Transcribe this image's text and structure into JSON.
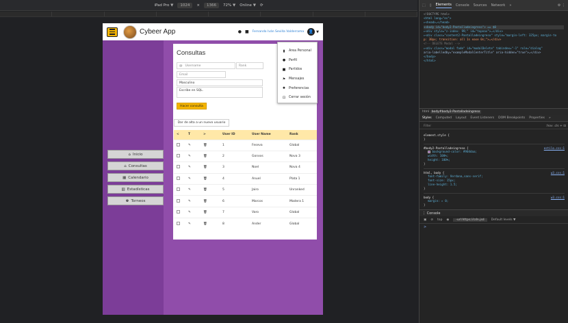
{
  "device_toolbar": {
    "device": "iPad Pro",
    "width": "1024",
    "times": "×",
    "height": "1366",
    "zoom": "72%",
    "network": "Online",
    "caret": "▼"
  },
  "topnav": {
    "app_title": "Cybeer App",
    "user_name": "Fernando Iván Sevilla Valderrama",
    "avatar_glyph": "👤"
  },
  "sidebar": {
    "items": [
      {
        "label": "Inicio",
        "icon": "home-icon",
        "glyph": "⌂"
      },
      {
        "label": "Consultas",
        "icon": "home-icon",
        "glyph": "⌂"
      },
      {
        "label": "Calendario",
        "icon": "calendar-icon",
        "glyph": "▦"
      },
      {
        "label": "Estadísticas",
        "icon": "chart-icon",
        "glyph": "▥"
      },
      {
        "label": "Torneos",
        "icon": "trophy-icon",
        "glyph": "♚"
      }
    ]
  },
  "consultas": {
    "title": "Consultas",
    "username_prefix": "@",
    "username_placeholder": "Username",
    "rank_placeholder": "Rank",
    "email_placeholder": "Email",
    "gender_value": "Masculino",
    "sql_placeholder": "Escribe en SQL.",
    "query_button": "Hacer consulta",
    "add_user_button": "Dar de alta a un nuevo usuario"
  },
  "table": {
    "headers": [
      "",
      "",
      "",
      "User ID",
      "User Name",
      "Rank"
    ],
    "sort_glyphs": [
      "<",
      "T",
      ">"
    ],
    "edit_glyph": "✎",
    "delete_glyph": "🗑",
    "rows": [
      {
        "id": "1",
        "name": "Fesevа",
        "rank": "Global"
      },
      {
        "id": "2",
        "name": "Gonxxs",
        "rank": "Nova 3"
      },
      {
        "id": "3",
        "name": "Noel",
        "rank": "Nova 4"
      },
      {
        "id": "4",
        "name": "Anuel",
        "rank": "Plata 1"
      },
      {
        "id": "5",
        "name": "Jairo",
        "rank": "Unranked"
      },
      {
        "id": "6",
        "name": "Marcos",
        "rank": "Madera 1"
      },
      {
        "id": "7",
        "name": "Varo",
        "rank": "Global"
      },
      {
        "id": "8",
        "name": "Ander",
        "rank": "Global"
      }
    ]
  },
  "dropdown": {
    "items": [
      {
        "label": "Area Personal",
        "icon": "bar-chart-icon",
        "glyph": "▮"
      },
      {
        "label": "Perfil",
        "icon": "user-icon",
        "glyph": "●"
      },
      {
        "label": "Partidos",
        "icon": "gamepad-icon",
        "glyph": "■"
      },
      {
        "label": "Mensajes",
        "icon": "flag-icon",
        "glyph": "⚑"
      },
      {
        "label": "Preferencias",
        "icon": "gear-icon",
        "glyph": "✹"
      },
      {
        "label": "Cerrar sesión",
        "icon": "logout-icon",
        "glyph": "⊡"
      }
    ]
  },
  "devtools": {
    "tabs": [
      "Elements",
      "Console",
      "Sources",
      "Network",
      "»"
    ],
    "dom_lines": [
      "<!DOCTYPE html>",
      "<html lang=\"es\">",
      "▸<head>…</head>",
      "▾<body id=\"body2-Pantalladeingreso\"> == $0",
      "  ▸<div style=\"z-index: 99;\" id=\"topnav\">…</div>",
      "  ▸<div class=\"content2-Pantalladeingreso\" style=\"margin-left: 325px; margin-to",
      "  p: 30px; transition: all 1s ease 0s;\">…</div>",
      "  <!-- DELETE Modal -->",
      "  ▸<div class=\"modal fade\" id=\"modalDelete\" tabindex=\"-1\" role=\"dialog\"",
      "  aria-labelledby=\"exampleModalCenterTitle\" aria-hidden=\"true\">…</div>",
      "  </body>",
      "</html>"
    ],
    "breadcrumb": [
      "html",
      "body#body2-Pantalladeingreso"
    ],
    "style_tabs": [
      "Styles",
      "Computed",
      "Layout",
      "Event Listeners",
      "DOM Breakpoints",
      "Properties",
      "»"
    ],
    "filter_placeholder": "Filter",
    "filter_right": ":hov .cls + ⊡",
    "rules": [
      {
        "selector": "element.style {",
        "props": [],
        "close": "}",
        "src": ""
      },
      {
        "selector": "#body2-Pantalladeingreso {",
        "props": [
          "background-color: #904daa;",
          "width: 100%;",
          "height: 100%;"
        ],
        "close": "}",
        "src": "estilo.css:1"
      },
      {
        "selector": "html, body {",
        "props": [
          "font-family: Verdana,sans-serif;",
          "font-size: 15px;",
          "line-height: 1.5;"
        ],
        "close": "}",
        "src": "w3.css:1"
      },
      {
        "selector": "body {",
        "props": [
          "margin: ▸ 0;"
        ],
        "close": "}",
        "src": "w3.css:1"
      }
    ],
    "console_label": "Console",
    "console_context": "top",
    "console_filter": "-url:https://cdn.jsd",
    "console_levels": "Default levels ▼",
    "prompt": ">"
  }
}
